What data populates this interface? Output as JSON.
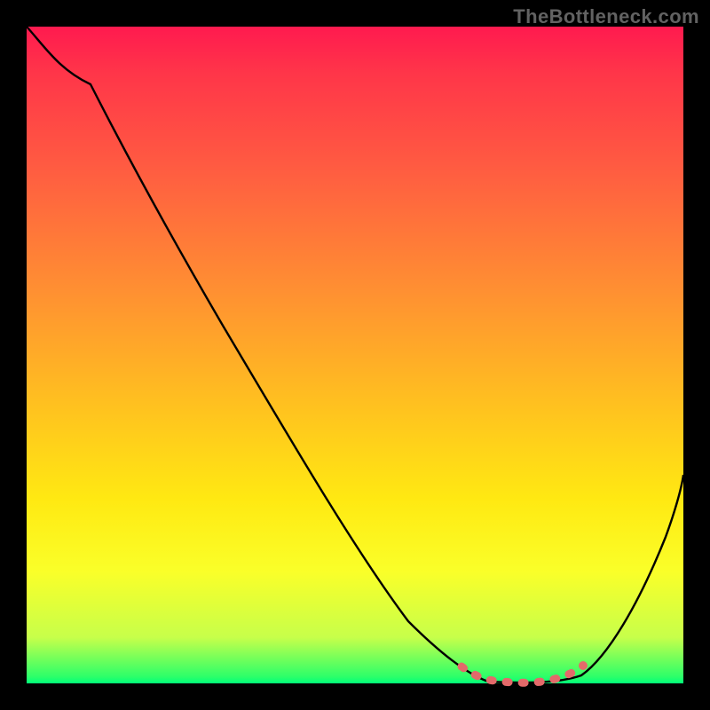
{
  "watermark": "TheBottleneck.com",
  "chart_data": {
    "type": "line",
    "title": "",
    "xlabel": "",
    "ylabel": "",
    "xlim": [
      0,
      100
    ],
    "ylim": [
      0,
      100
    ],
    "series": [
      {
        "name": "bottleneck-curve",
        "x": [
          0,
          5,
          10,
          20,
          30,
          40,
          50,
          55,
          60,
          65,
          68,
          70,
          72,
          75,
          78,
          82,
          86,
          90,
          94,
          98,
          100
        ],
        "values": [
          100,
          97,
          92,
          80,
          66,
          51,
          36,
          28,
          20,
          11,
          6,
          3,
          1,
          0,
          0,
          0,
          2,
          8,
          17,
          27,
          32
        ]
      },
      {
        "name": "optimal-range-marker",
        "x": [
          68,
          70,
          72,
          74,
          76,
          78,
          80,
          82,
          84
        ],
        "values": [
          2.5,
          1.2,
          0.5,
          0.2,
          0.1,
          0.2,
          0.5,
          1.2,
          2.5
        ]
      }
    ],
    "gradient_stops": [
      {
        "pos": 0,
        "color": "#ff1a4f"
      },
      {
        "pos": 7,
        "color": "#ff3549"
      },
      {
        "pos": 22,
        "color": "#ff5d41"
      },
      {
        "pos": 40,
        "color": "#ff8f32"
      },
      {
        "pos": 58,
        "color": "#ffc21f"
      },
      {
        "pos": 72,
        "color": "#ffe912"
      },
      {
        "pos": 83,
        "color": "#faff29"
      },
      {
        "pos": 93,
        "color": "#c7ff4a"
      },
      {
        "pos": 99,
        "color": "#2cff69"
      },
      {
        "pos": 100,
        "color": "#00ff7a"
      }
    ],
    "curve_color": "#000000",
    "marker_color": "#e36a6a"
  }
}
